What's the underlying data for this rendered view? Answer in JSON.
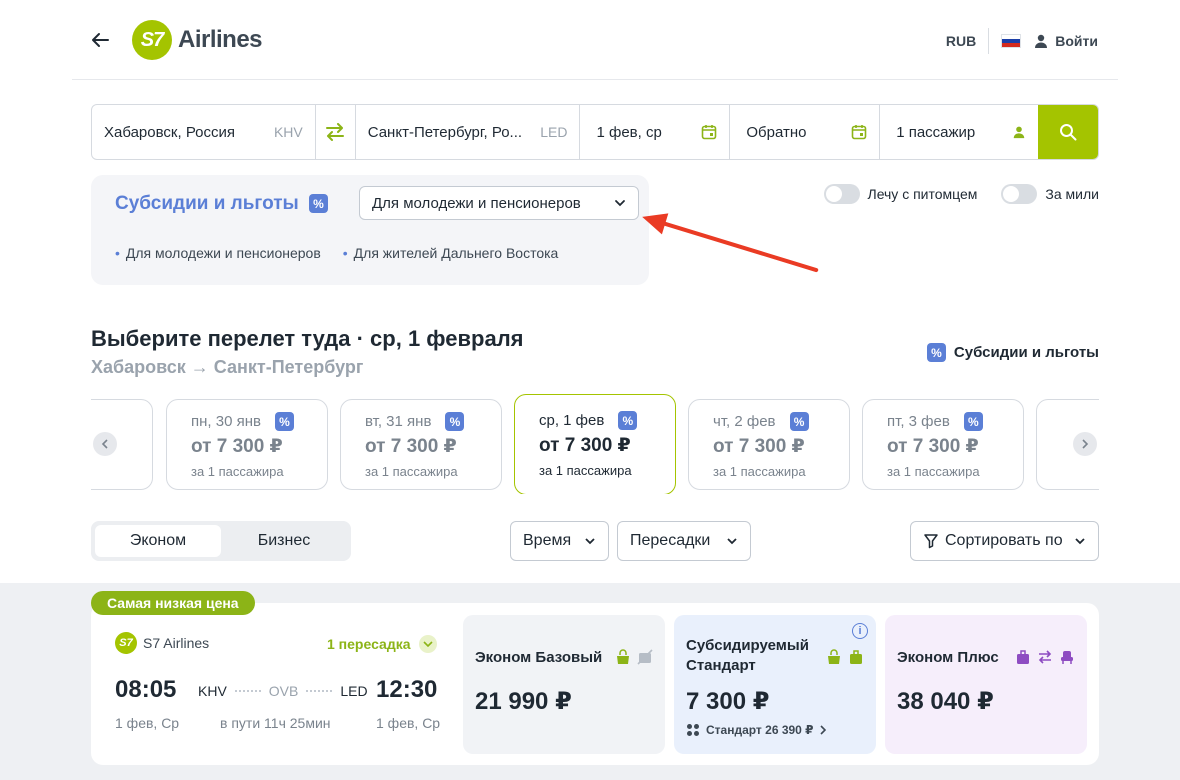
{
  "header": {
    "logo_mark": "S7",
    "logo_text": "Airlines",
    "currency": "RUB",
    "login": "Войти",
    "colors": {
      "brand": "#a4c400",
      "accent": "#5b7fd6"
    }
  },
  "search": {
    "from": "Хабаровск, Россия",
    "from_code": "KHV",
    "to": "Санкт-Петербург, Ро...",
    "to_code": "LED",
    "depart": "1 фев, ср",
    "return": "Обратно",
    "passengers": "1 пассажир"
  },
  "subsidies": {
    "title": "Субсидии и льготы",
    "badge": "%",
    "selected": "Для молодежи и пенсионеров",
    "options": [
      "Для молодежи и пенсионеров",
      "Для жителей Дальнего Востока"
    ]
  },
  "toggles": {
    "pet": "Лечу с питомцем",
    "miles": "За мили"
  },
  "selection": {
    "title": "Выберите перелет туда · ср, 1 февраля",
    "route": "Хабаровск → Санкт-Петербург",
    "subsidy_link": "Субсидии и льготы"
  },
  "dates": [
    {
      "day": "пн, 30 янв",
      "price": "от 7 300 ₽",
      "per": "за 1 пассажира"
    },
    {
      "day": "вт, 31 янв",
      "price": "от 7 300 ₽",
      "per": "за 1 пассажира"
    },
    {
      "day": "ср, 1 фев",
      "price": "от 7 300 ₽",
      "per": "за 1 пассажира"
    },
    {
      "day": "чт, 2 фев",
      "price": "от 7 300 ₽",
      "per": "за 1 пассажира"
    },
    {
      "day": "пт, 3 фев",
      "price": "от 7 300 ₽",
      "per": "за 1 пассажира"
    }
  ],
  "filters": {
    "economy": "Эконом",
    "business": "Бизнес",
    "time": "Время",
    "transfers": "Пересадки",
    "sort": "Сортировать по"
  },
  "flight": {
    "badge": "Самая низкая цена",
    "airline": "S7 Airlines",
    "transfers": "1 пересадка",
    "dep_time": "08:05",
    "dep_code": "KHV",
    "via_code": "OVB",
    "arr_code": "LED",
    "arr_time": "12:30",
    "dep_date": "1 фев, Ср",
    "duration": "в пути 11ч 25мин",
    "arr_date": "1 фев, Ср",
    "fares": [
      {
        "name": "Эконом Базовый",
        "price": "21 990 ₽"
      },
      {
        "name_line1": "Субсидируемый",
        "name_line2": "Стандарт",
        "price": "7 300 ₽",
        "link": "Стандарт 26 390 ₽"
      },
      {
        "name": "Эконом Плюс",
        "price": "38 040 ₽"
      }
    ]
  }
}
